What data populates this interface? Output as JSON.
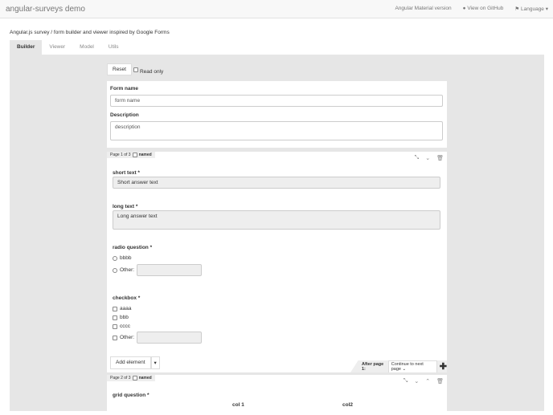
{
  "navbar": {
    "brand": "angular-surveys demo",
    "links": [
      "Angular Material version",
      "View on GitHub",
      "Language"
    ]
  },
  "subtitle": "Angular.js survey / form builder and viewer inspired by Google Forms",
  "tabs": [
    "Builder",
    "Viewer",
    "Model",
    "Utils"
  ],
  "toolbar": {
    "reset": "Reset",
    "read_only": "Read only"
  },
  "form": {
    "name_label": "Form name",
    "name_placeholder": "form name",
    "desc_label": "Description",
    "desc_placeholder": "description"
  },
  "page1": {
    "header": "Page 1 of 3",
    "named": "named",
    "q1": {
      "label": "short text *",
      "placeholder": "Short answer text"
    },
    "q2": {
      "label": "long text *",
      "placeholder": "Long answer text"
    },
    "q3": {
      "label": "radio question *",
      "options": [
        "bbbb",
        "Other:"
      ]
    },
    "q4": {
      "label": "checkbox *",
      "options": [
        "aaaa",
        "bbb",
        "cccc",
        "Other:"
      ]
    },
    "add_element": "Add element",
    "after_label": "After page 1:",
    "after_value": "Continue to next page"
  },
  "page2": {
    "header": "Page 2 of 3",
    "named": "named",
    "q1": {
      "label": "grid question *",
      "cols": [
        "col 1",
        "col2"
      ]
    }
  }
}
